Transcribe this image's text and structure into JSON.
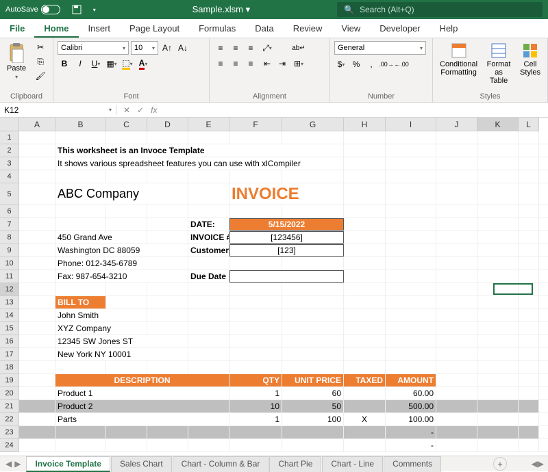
{
  "titlebar": {
    "autosave": "AutoSave",
    "filename": "Sample.xlsm",
    "search_placeholder": "Search (Alt+Q)"
  },
  "tabs": [
    "File",
    "Home",
    "Insert",
    "Page Layout",
    "Formulas",
    "Data",
    "Review",
    "View",
    "Developer",
    "Help"
  ],
  "ribbon": {
    "clipboard": {
      "paste": "Paste",
      "label": "Clipboard"
    },
    "font": {
      "name": "Calibri",
      "size": "10",
      "label": "Font"
    },
    "alignment": {
      "label": "Alignment"
    },
    "number": {
      "format": "General",
      "label": "Number"
    },
    "styles": {
      "cf": "Conditional Formatting",
      "fat": "Format as Table",
      "cs": "Cell Styles",
      "label": "Styles"
    }
  },
  "namebox": "K12",
  "cols": [
    "A",
    "B",
    "C",
    "D",
    "E",
    "F",
    "G",
    "H",
    "I",
    "J",
    "K",
    "L"
  ],
  "sheet": {
    "title_line": "This worksheet is an Invoce Template",
    "subtitle": "It shows various spreadsheet features you can use with xlCompiler",
    "company": "ABC Company",
    "invoice": "INVOICE",
    "date_lbl": "DATE:",
    "date_val": "5/15/2022",
    "invno_lbl": "INVOICE #",
    "invno_val": "[123456]",
    "cust_lbl": "Customer ID",
    "cust_val": "[123]",
    "due_lbl": "Due Date",
    "addr1": "450 Grand Ave",
    "addr2": "Washington DC 88059",
    "addr3": "Phone: 012-345-6789",
    "addr4": "Fax: 987-654-3210",
    "billto": "BILL TO",
    "b1": "John Smith",
    "b2": "XYZ Company",
    "b3": "12345 SW Jones ST",
    "b4": "New York NY 10001",
    "hdr_desc": "DESCRIPTION",
    "hdr_qty": "QTY",
    "hdr_price": "UNIT PRICE",
    "hdr_tax": "TAXED",
    "hdr_amt": "AMOUNT",
    "rows": [
      {
        "d": "Product 1",
        "q": "1",
        "p": "60",
        "t": "",
        "a": "60.00"
      },
      {
        "d": "Product 2",
        "q": "10",
        "p": "50",
        "t": "",
        "a": "500.00"
      },
      {
        "d": "Parts",
        "q": "1",
        "p": "100",
        "t": "X",
        "a": "100.00"
      }
    ],
    "dash1": "-",
    "dash2": "-"
  },
  "sheettabs": [
    "Invoice Template",
    "Sales Chart",
    "Chart - Column & Bar",
    "Chart Pie",
    "Chart - Line",
    "Comments"
  ]
}
